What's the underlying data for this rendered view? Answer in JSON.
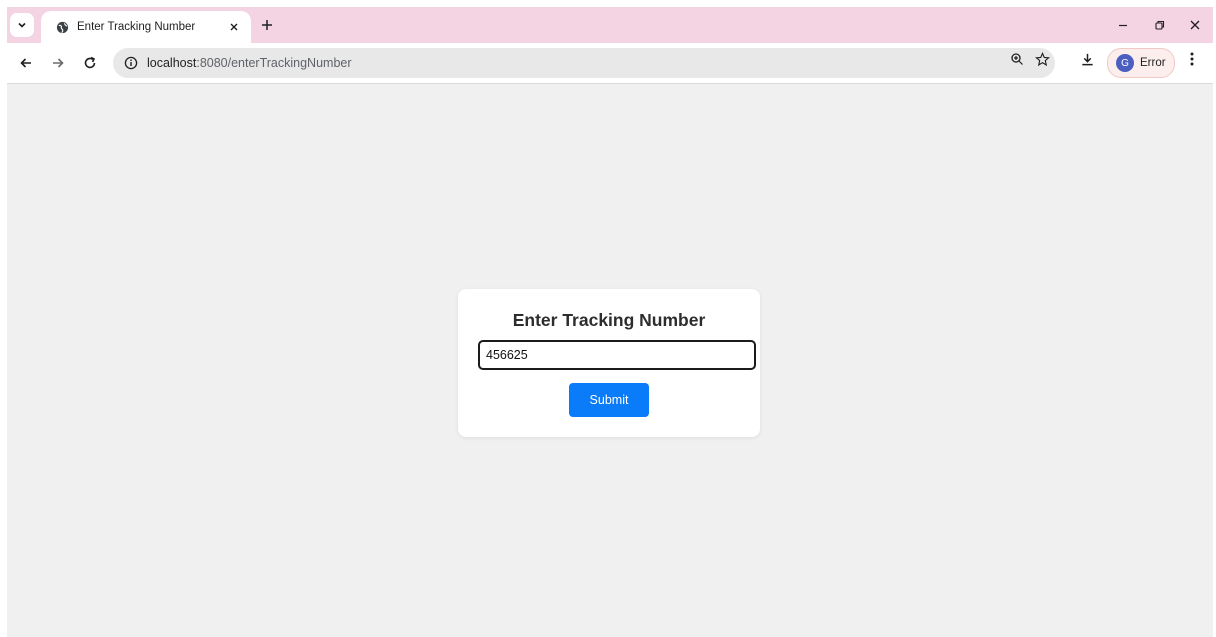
{
  "browser": {
    "tab": {
      "title": "Enter Tracking Number"
    },
    "address_bar": {
      "host": "localhost",
      "path": ":8080/enterTrackingNumber"
    },
    "profile": {
      "initial": "G",
      "label": "Error"
    }
  },
  "page": {
    "heading": "Enter Tracking Number",
    "tracking_input": {
      "value": "456625"
    },
    "submit_label": "Submit"
  },
  "colors": {
    "tabstrip": "#f4d3e2",
    "page_background": "#f0f0f0",
    "submit_button": "#0a7bf9"
  }
}
